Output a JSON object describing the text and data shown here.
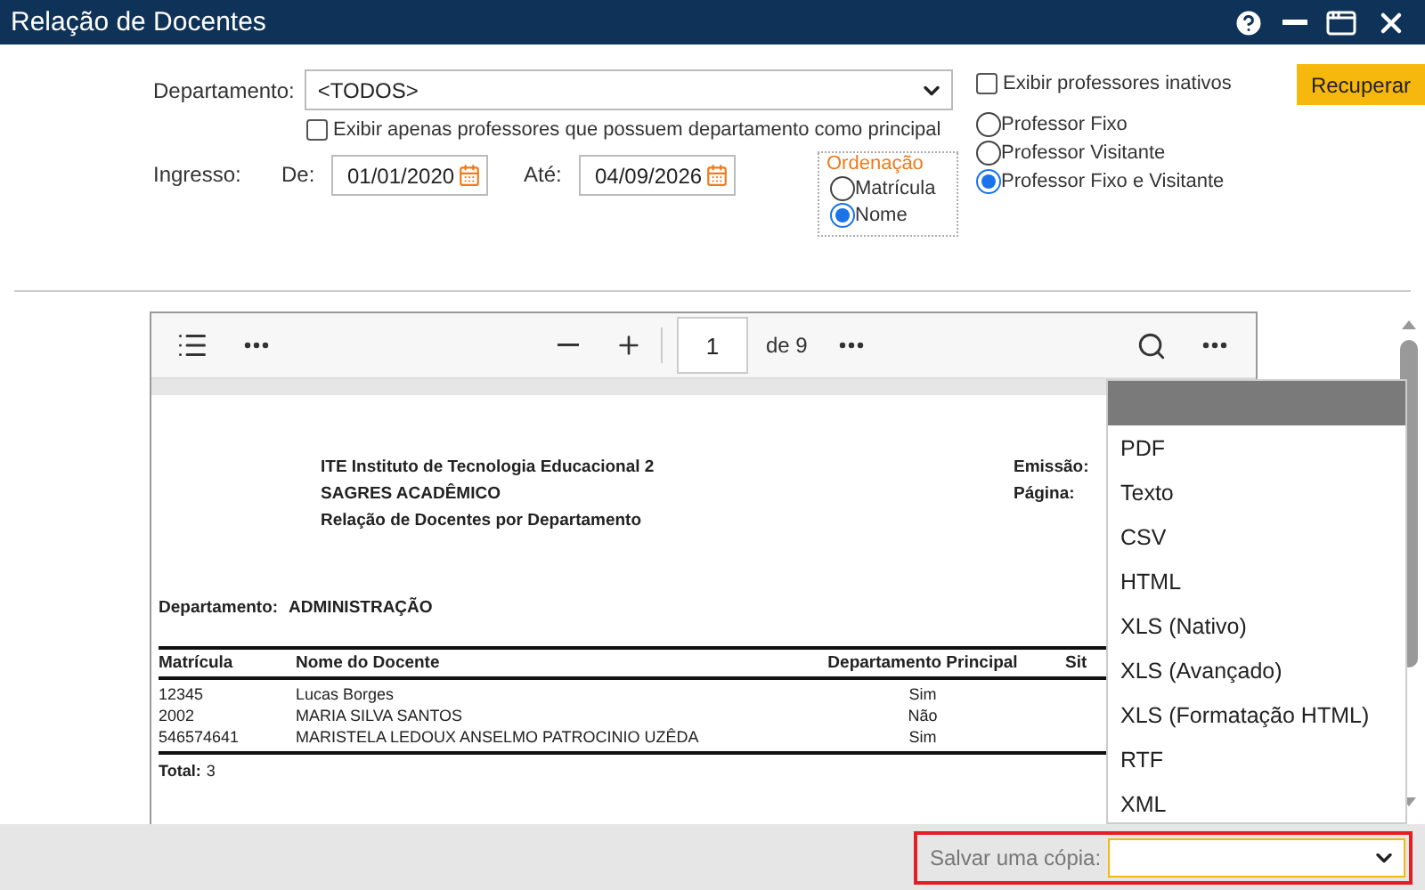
{
  "window": {
    "title": "Relação de Docentes"
  },
  "filters": {
    "department": {
      "label": "Departamento:",
      "value": "<TODOS>"
    },
    "principal_only": {
      "label": "Exibir apenas professores que possuem departamento como principal",
      "checked": false
    },
    "admission": {
      "label": "Ingresso:",
      "from": {
        "label": "De:",
        "value": "01/01/2020"
      },
      "to": {
        "label": "Até:",
        "value": "04/09/2026"
      }
    },
    "ordering": {
      "title": "Ordenação",
      "options": [
        {
          "label": "Matrícula",
          "selected": false
        },
        {
          "label": "Nome",
          "selected": true
        }
      ]
    },
    "show_inactive": {
      "label": "Exibir professores inativos",
      "checked": false
    },
    "professor_types": [
      {
        "label": "Professor Fixo",
        "selected": false
      },
      {
        "label": "Professor Visitante",
        "selected": false
      },
      {
        "label": "Professor Fixo e Visitante",
        "selected": true
      }
    ],
    "retrieve_button": "Recuperar"
  },
  "viewer": {
    "page": "1",
    "page_count": "de 9"
  },
  "report": {
    "header_lines": [
      "ITE Instituto de Tecnologia Educacional 2",
      "SAGRES ACADÊMICO",
      "Relação de Docentes por Departamento"
    ],
    "meta_labels": [
      "Emissão:",
      "Página:"
    ],
    "department": {
      "label": "Departamento:",
      "value": "ADMINISTRAÇÃO"
    },
    "columns": [
      "Matrícula",
      "Nome do Docente",
      "Departamento Principal",
      "Sit"
    ],
    "rows": [
      {
        "cells": [
          "12345",
          "Lucas Borges",
          "Sim"
        ]
      },
      {
        "cells": [
          "2002",
          "MARIA SILVA SANTOS",
          "Não"
        ]
      },
      {
        "cells": [
          "546574641",
          "MARISTELA LEDOUX ANSELMO PATROCINIO UZÊDA",
          "Sim"
        ]
      }
    ],
    "total": {
      "label": "Total:",
      "value": "3"
    }
  },
  "export_menu": {
    "options": [
      "PDF",
      "Texto",
      "CSV",
      "HTML",
      "XLS (Nativo)",
      "XLS (Avançado)",
      "XLS (Formatação HTML)",
      "RTF",
      "XML"
    ]
  },
  "save_copy": {
    "label": "Salvar uma cópia:"
  }
}
